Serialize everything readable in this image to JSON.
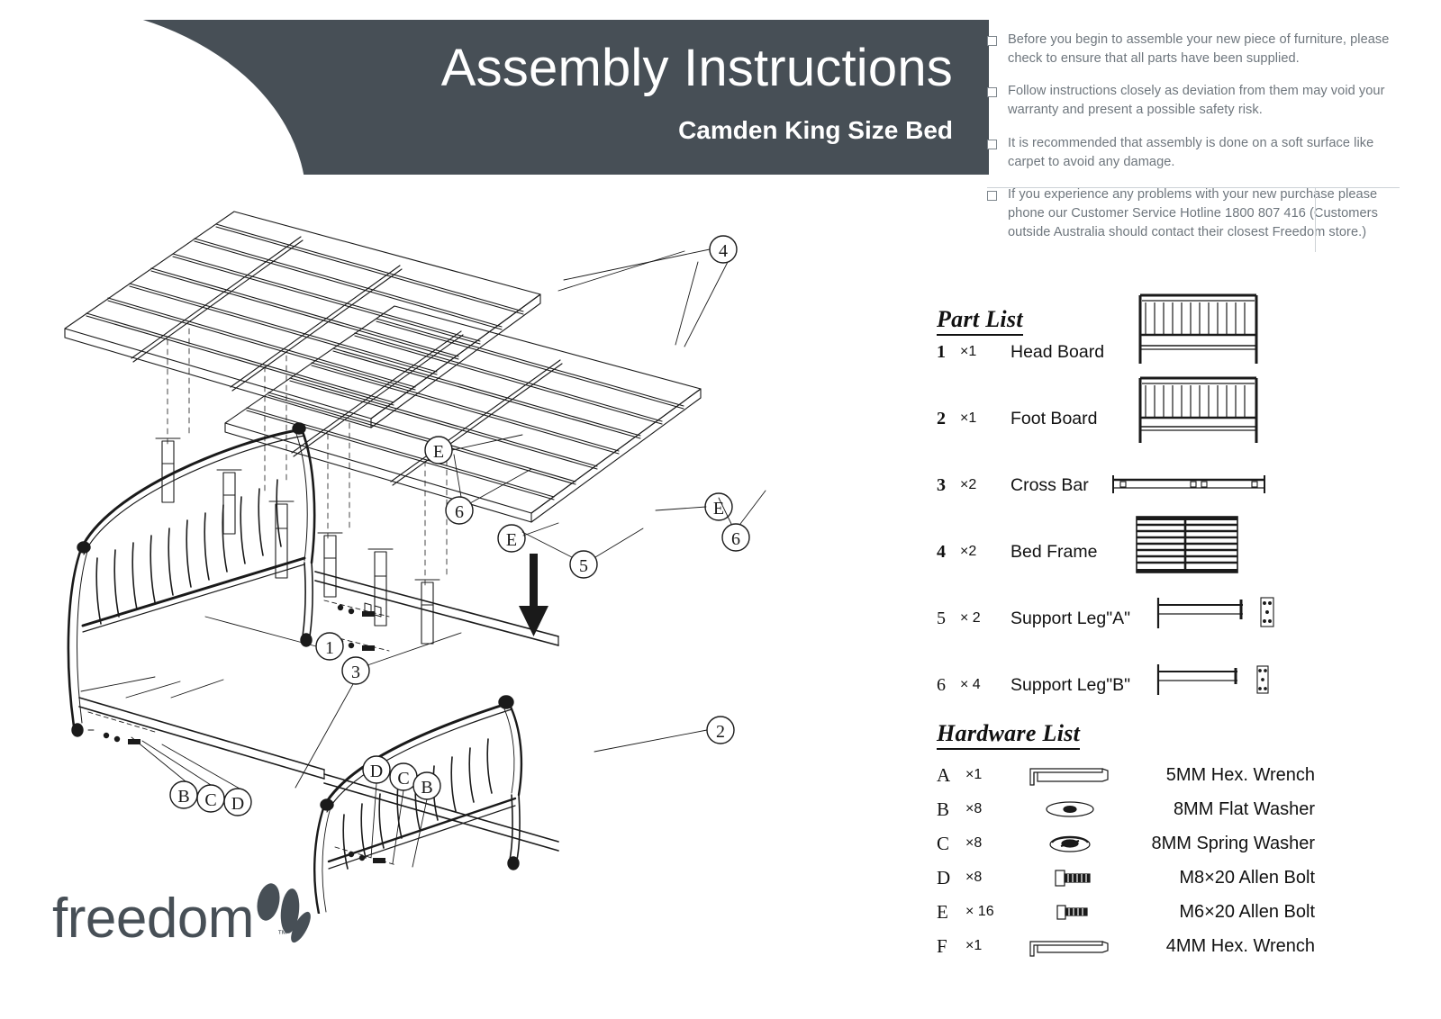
{
  "header": {
    "title": "Assembly Instructions",
    "subtitle": "Camden King Size Bed"
  },
  "notes": [
    "Before you begin to assemble your new piece of furniture, please check to ensure that all parts have been supplied.",
    "Follow instructions closely as deviation from them may void your warranty and present a possible safety risk.",
    "It is recommended that assembly is done on a soft surface like carpet to avoid any damage.",
    "If you experience any problems with your new purchase please phone our Customer Service Hotline 1800 807 416 (Customers outside Australia should contact their closest Freedom store.)"
  ],
  "part_list": {
    "heading": "Part List",
    "items": [
      {
        "num": "1",
        "qty": "×1",
        "name": "Head Board",
        "figure": "headboard-figure",
        "bold": true
      },
      {
        "num": "2",
        "qty": "×1",
        "name": "Foot Board",
        "figure": "footboard-figure",
        "bold": true
      },
      {
        "num": "3",
        "qty": "×2",
        "name": "Cross Bar",
        "figure": "crossbar-figure",
        "bold": true
      },
      {
        "num": "4",
        "qty": "×2",
        "name": "Bed Frame",
        "figure": "bedframe-figure",
        "bold": true
      },
      {
        "num": "5",
        "qty": "× 2",
        "name": "Support Leg\"A\"",
        "figure": "support-leg-a-figure",
        "bold": false
      },
      {
        "num": "6",
        "qty": "× 4",
        "name": "Support Leg\"B\"",
        "figure": "support-leg-b-figure",
        "bold": false
      }
    ]
  },
  "hardware_list": {
    "heading": "Hardware List",
    "items": [
      {
        "letter": "A",
        "qty": "×1",
        "name": "5MM Hex. Wrench",
        "icon": "hex-wrench-icon"
      },
      {
        "letter": "B",
        "qty": "×8",
        "name": "8MM Flat Washer",
        "icon": "flat-washer-icon"
      },
      {
        "letter": "C",
        "qty": "×8",
        "name": "8MM Spring Washer",
        "icon": "spring-washer-icon"
      },
      {
        "letter": "D",
        "qty": "×8",
        "name": "M8×20 Allen Bolt",
        "icon": "allen-bolt-icon"
      },
      {
        "letter": "E",
        "qty": "× 16",
        "name": "M6×20 Allen Bolt",
        "icon": "allen-bolt-icon"
      },
      {
        "letter": "F",
        "qty": "×1",
        "name": "4MM Hex. Wrench",
        "icon": "hex-wrench-icon"
      }
    ]
  },
  "diagram": {
    "callouts": [
      {
        "label": "4"
      },
      {
        "label": "E"
      },
      {
        "label": "6"
      },
      {
        "label": "E"
      },
      {
        "label": "5"
      },
      {
        "label": "E"
      },
      {
        "label": "6"
      },
      {
        "label": "1"
      },
      {
        "label": "3"
      },
      {
        "label": "2"
      },
      {
        "label": "B"
      },
      {
        "label": "C"
      },
      {
        "label": "D"
      },
      {
        "label": "D"
      },
      {
        "label": "C"
      },
      {
        "label": "B"
      }
    ]
  },
  "logo": {
    "word": "freedom",
    "trademark": "™"
  },
  "colors": {
    "banner": "#474f56",
    "note_text": "#6e767d",
    "line": "#1a1a1a"
  }
}
